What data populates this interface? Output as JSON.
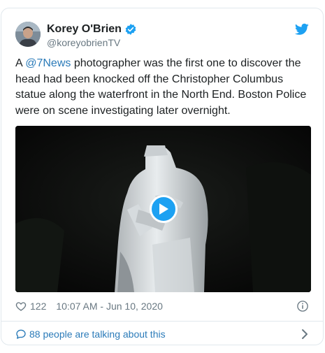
{
  "tweet": {
    "display_name": "Korey O'Brien",
    "handle": "@koreyobrienTV",
    "text_before": "A ",
    "mention": "@7News",
    "text_after": " photographer was the first one to discover the head had been knocked off the Christopher Columbus statue along the waterfront in the North End. Boston Police were on scene investigating later overnight.",
    "like_count": "122",
    "timestamp": "10:07 AM - Jun 10, 2020",
    "talking_text": "88 people are talking about this"
  },
  "icons": {
    "verified": "verified-badge-icon",
    "logo": "twitter-bird-icon",
    "like": "heart-icon",
    "info": "info-icon",
    "conversation": "speech-bubble-icon",
    "chevron": "chevron-right-icon",
    "play": "play-icon"
  },
  "colors": {
    "link": "#2b7bb9",
    "brand": "#1da1f2",
    "muted": "#697882",
    "border": "#e1e8ed"
  }
}
